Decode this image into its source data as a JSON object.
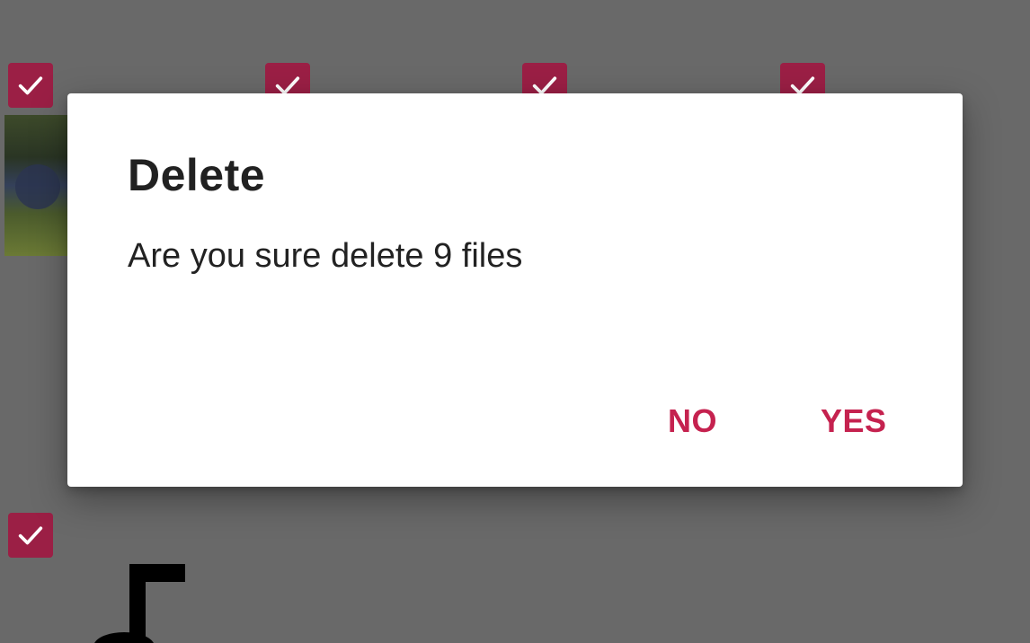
{
  "dialog": {
    "title": "Delete",
    "message": "Are you sure delete 9 files",
    "no_label": "NO",
    "yes_label": "YES"
  },
  "grid": {
    "selected_check_icon": "checkmark-icon",
    "accent_color": "#9b1f45"
  },
  "colors": {
    "scrim": "#696969",
    "button_text": "#c5224f"
  }
}
